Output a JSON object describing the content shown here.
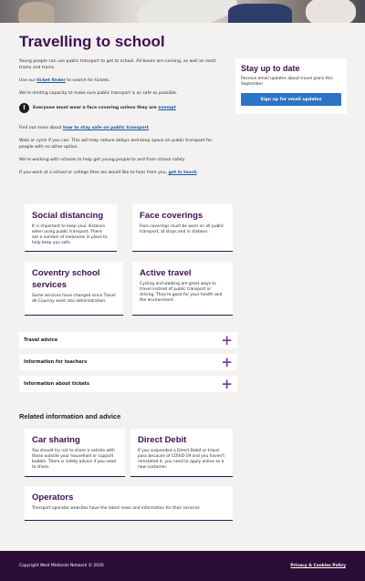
{
  "page": {
    "title": "Travelling to school"
  },
  "intro": {
    "p1": "Young people can use public transport to get to school. All buses are running, as well as most trams and trains.",
    "p2_before": "Use our ",
    "p2_link": "ticket finder",
    "p2_after": " to search for tickets.",
    "p3": "We're limiting capacity to make sure public transport is as safe as possible.",
    "warning_before": "Everyone must wear a face covering unless they are ",
    "warning_link": "exempt",
    "warning_icon": "exclamation-icon",
    "p4_before": "Find out more about ",
    "p4_link": "how to stay safe on public transport",
    "p4_after": ".",
    "p5": "Walk or cycle if you can. This will help reduce delays and keep space on public transport for people with no other option.",
    "p6": "We're working with schools to help get young people to and from school safely.",
    "p7_before": "If you work at a school or college then we would like to hear from you, ",
    "p7_link": "get in touch",
    "p7_after": "."
  },
  "stay_up_to_date": {
    "heading": "Stay up to date",
    "text": "Receive email updates about travel plans this September",
    "button": "Sign up for email updates"
  },
  "cards": [
    {
      "title": "Social distancing",
      "text": "It is important to keep your distance when using public transport. There are a number of measures in place to help keep you safe."
    },
    {
      "title": "Face coverings",
      "text": "Face coverings must be worn on all public transport, at stops and in stations."
    },
    {
      "title": "Coventry school services",
      "text": "Some services have changed since Travel de Courcey went into administration."
    },
    {
      "title": "Active travel",
      "text": "Cycling and walking are great ways to travel instead of public transport or driving. They're good for your health and the environment."
    }
  ],
  "accordions": [
    {
      "label": "Travel advice"
    },
    {
      "label": "Information for teachers"
    },
    {
      "label": "Information about tickets"
    }
  ],
  "related": {
    "heading": "Related information and advice",
    "cards": [
      {
        "title": "Car sharing",
        "text": "You should try not to share a vehicle with those outside your household or support bubble. There is safety advice if you need to share."
      },
      {
        "title": "Direct Debit",
        "text": "If you suspended a Direct Debit or travel pass because of COVID-19 and you haven't reinstated it, you need to apply online as a new customer."
      },
      {
        "title": "Operators",
        "text": "Transport operator websites have the latest news and information for their services"
      }
    ]
  },
  "footer": {
    "copyright": "Copyright West Midlands Network © 2020",
    "policy": "Privacy & Cookies Policy"
  },
  "colors": {
    "brand_purple": "#3c1053",
    "button_blue": "#2d74c4",
    "footer_bg": "#2b0e37",
    "accent_plus": "#7b3f9d"
  }
}
